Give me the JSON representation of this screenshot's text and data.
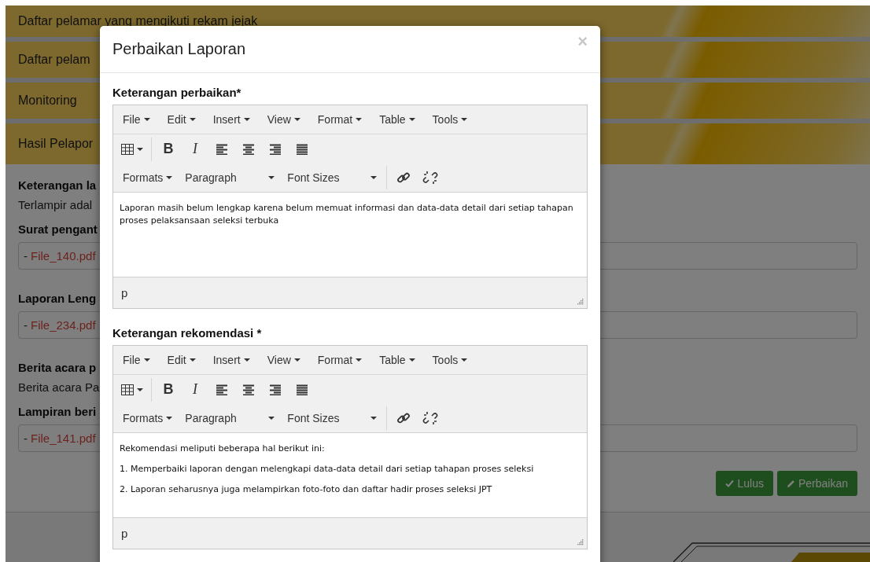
{
  "accordion": [
    {
      "title": "Daftar pelamar yang mengikuti rekam jejak"
    },
    {
      "title": "Daftar pelam"
    },
    {
      "title": "Monitoring"
    },
    {
      "title": "Hasil Pelapor"
    }
  ],
  "report": [
    {
      "kind": "label",
      "text": "Keterangan la"
    },
    {
      "kind": "text",
      "text": "Terlampir adal"
    },
    {
      "kind": "label",
      "text": "Surat pengant"
    },
    {
      "kind": "file",
      "prefix": "-",
      "link": "File_140.pdf"
    },
    {
      "kind": "label",
      "text": "Laporan Leng"
    },
    {
      "kind": "file",
      "prefix": "-",
      "link": "File_234.pdf"
    },
    {
      "kind": "label",
      "text": "Berita acara p"
    },
    {
      "kind": "text",
      "text": "Berita acara Pa"
    },
    {
      "kind": "label",
      "text": "Lampiran beri"
    },
    {
      "kind": "file",
      "prefix": "-",
      "link": "File_141.pdf"
    }
  ],
  "actions": [
    {
      "kind": "check",
      "label": "Lulus"
    },
    {
      "kind": "pencil",
      "label": "Perbaikan"
    }
  ],
  "modal": {
    "title": "Perbaikan Laporan",
    "close": "×",
    "editors": [
      {
        "label": "Keterangan perbaikan*",
        "menus": [
          "File",
          "Edit",
          "Insert",
          "View",
          "Format",
          "Table",
          "Tools"
        ],
        "bold": "B",
        "italic": "I",
        "formats": "Formats",
        "block": "Paragraph",
        "sizes": "Font Sizes",
        "paragraphs": [
          "Laporan masih belum lengkap karena belum memuat informasi dan data-data detail dari setiap tahapan proses pelaksansaan seleksi terbuka"
        ],
        "path": "p"
      },
      {
        "label": "Keterangan rekomendasi *",
        "menus": [
          "File",
          "Edit",
          "Insert",
          "View",
          "Format",
          "Table",
          "Tools"
        ],
        "bold": "B",
        "italic": "I",
        "formats": "Formats",
        "block": "Paragraph",
        "sizes": "Font Sizes",
        "paragraphs": [
          "Rekomendasi meliputi beberapa hal berikut ini:",
          "1. Memperbaiki laporan dengan melengkapi data-data detail dari setiap tahapan proses seleksi",
          "2. Laporan seharusnya juga melampirkan foto-foto dan daftar hadir proses seleksi JPT"
        ],
        "path": "p"
      }
    ]
  }
}
